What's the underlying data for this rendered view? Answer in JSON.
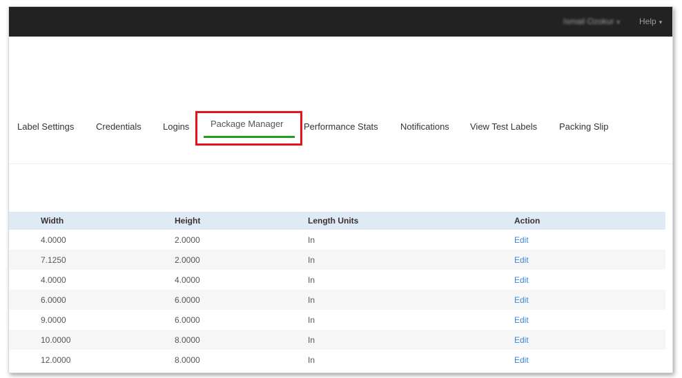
{
  "topbar": {
    "user_name": "Ismail Ozokur",
    "help_label": "Help",
    "caret": "▾"
  },
  "tabs": [
    {
      "label": "Label Settings"
    },
    {
      "label": "Credentials"
    },
    {
      "label": "Logins"
    },
    {
      "label": "Package Manager",
      "active": true
    },
    {
      "label": "Performance Stats"
    },
    {
      "label": "Notifications"
    },
    {
      "label": "View Test Labels"
    },
    {
      "label": "Packing Slip"
    }
  ],
  "colors": {
    "active_tab_highlight_border": "#e8121c",
    "active_tab_underline": "#1e9e1e",
    "link": "#3a87d8",
    "header_bg": "#dfeaf5",
    "topbar_bg": "#222222"
  },
  "table": {
    "headers": [
      "Width",
      "Height",
      "Length Units",
      "Action"
    ],
    "rows": [
      {
        "width": "4.0000",
        "height": "2.0000",
        "units": "In",
        "action": "Edit"
      },
      {
        "width": "7.1250",
        "height": "2.0000",
        "units": "In",
        "action": "Edit"
      },
      {
        "width": "4.0000",
        "height": "4.0000",
        "units": "In",
        "action": "Edit"
      },
      {
        "width": "6.0000",
        "height": "6.0000",
        "units": "In",
        "action": "Edit"
      },
      {
        "width": "9.0000",
        "height": "6.0000",
        "units": "In",
        "action": "Edit"
      },
      {
        "width": "10.0000",
        "height": "8.0000",
        "units": "In",
        "action": "Edit"
      },
      {
        "width": "12.0000",
        "height": "8.0000",
        "units": "In",
        "action": "Edit"
      }
    ]
  }
}
